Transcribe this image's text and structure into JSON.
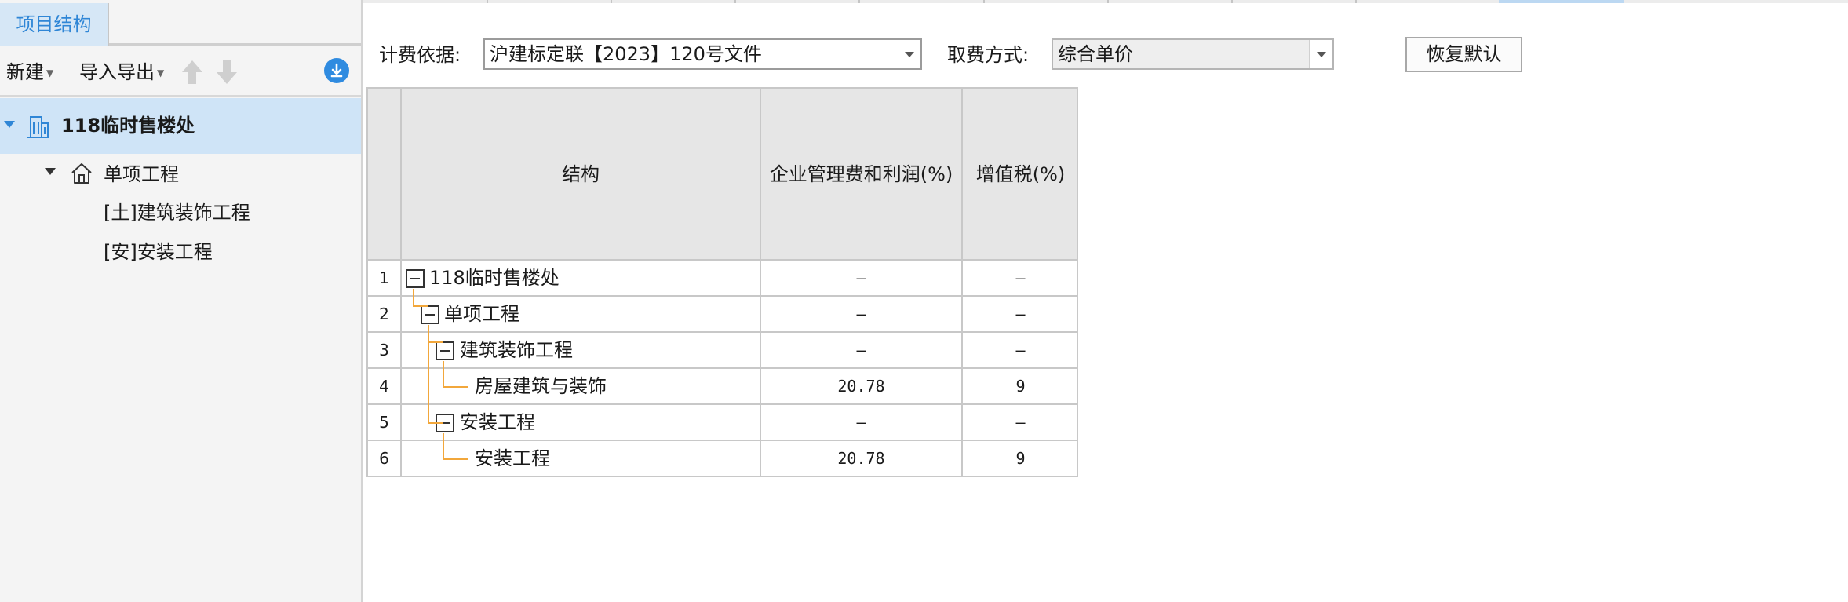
{
  "left_panel": {
    "tab_label": "项目结构",
    "toolbar": {
      "new_label": "新建",
      "import_export_label": "导入导出"
    },
    "tree": {
      "root": "118临时售楼处",
      "single": "单项工程",
      "children": [
        "[土]建筑装饰工程",
        "[安]安装工程"
      ]
    }
  },
  "settings": {
    "basis_label": "计费依据:",
    "basis_value": "沪建标定联【2023】120号文件",
    "method_label": "取费方式:",
    "method_value": "综合单价",
    "restore_label": "恢复默认"
  },
  "grid": {
    "columns": {
      "structure": "结构",
      "mgmt_profit": "企业管理费和利润(%)",
      "vat": "增值税(%)"
    },
    "rows": [
      {
        "num": "1",
        "name": "118临时售楼处",
        "mgmt": "—",
        "vat": "—"
      },
      {
        "num": "2",
        "name": "单项工程",
        "mgmt": "—",
        "vat": "—"
      },
      {
        "num": "3",
        "name": "建筑装饰工程",
        "mgmt": "—",
        "vat": "—"
      },
      {
        "num": "4",
        "name": "房屋建筑与装饰",
        "mgmt": "20.78",
        "vat": "9"
      },
      {
        "num": "5",
        "name": "安装工程",
        "mgmt": "—",
        "vat": "—"
      },
      {
        "num": "6",
        "name": "安装工程",
        "mgmt": "20.78",
        "vat": "9"
      }
    ]
  },
  "colors": {
    "accent_blue": "#2f86d6",
    "selection_bg": "#cfe4f7",
    "tree_line_orange": "#f2a73b"
  }
}
